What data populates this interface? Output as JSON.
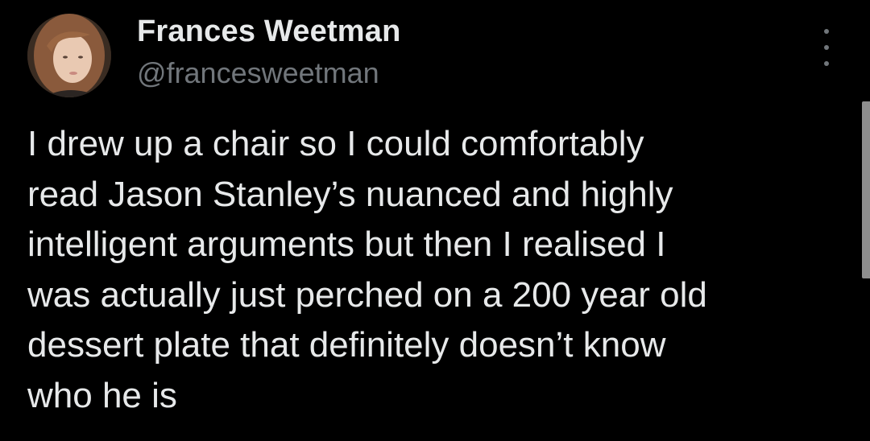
{
  "author": {
    "display_name": "Frances Weetman",
    "handle": "@francesweetman"
  },
  "avatar": {
    "icon": "profile-photo"
  },
  "more_button": {
    "icon": "more-options-icon"
  },
  "tweet": {
    "text": "I drew up a chair so I could comfortably\nread Jason Stanley’s nuanced and highly\nintelligent arguments but then I realised I\nwas actually just perched on a 200 year old\ndessert plate that definitely doesn’t know\nwho he is"
  },
  "colors": {
    "background": "#000000",
    "primary_text": "#e7e9ea",
    "secondary_text": "#71767b"
  }
}
